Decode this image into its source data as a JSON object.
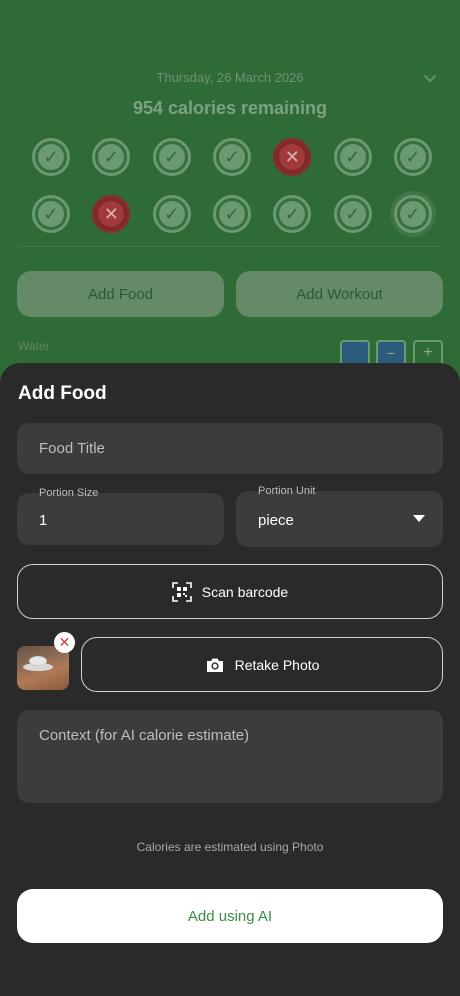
{
  "background": {
    "date": "Thursday, 26 March 2026",
    "calories_remaining": "954 calories remaining",
    "days_row1": [
      {
        "status": "check",
        "symbol": "✓"
      },
      {
        "status": "check",
        "symbol": "✓"
      },
      {
        "status": "check",
        "symbol": "✓"
      },
      {
        "status": "check",
        "symbol": "✓"
      },
      {
        "status": "fail",
        "symbol": "✕"
      },
      {
        "status": "check",
        "symbol": "✓"
      },
      {
        "status": "check",
        "symbol": "✓"
      }
    ],
    "days_row2": [
      {
        "status": "check",
        "symbol": "✓"
      },
      {
        "status": "fail",
        "symbol": "✕"
      },
      {
        "status": "check",
        "symbol": "✓"
      },
      {
        "status": "check",
        "symbol": "✓"
      },
      {
        "status": "check",
        "symbol": "✓"
      },
      {
        "status": "check",
        "symbol": "✓"
      },
      {
        "status": "today",
        "symbol": "✓"
      }
    ],
    "add_food_label": "Add Food",
    "add_workout_label": "Add Workout",
    "water_label": "Water",
    "water_cup_minus": "−",
    "water_plus": "+"
  },
  "sheet": {
    "title": "Add Food",
    "food_title_placeholder": "Food Title",
    "portion_size_label": "Portion Size",
    "portion_size_value": "1",
    "portion_unit_label": "Portion Unit",
    "portion_unit_value": "piece",
    "scan_barcode_label": "Scan barcode",
    "retake_photo_label": "Retake Photo",
    "remove_photo_symbol": "✕",
    "context_placeholder": "Context (for AI calorie estimate)",
    "hint": "Calories are estimated using Photo",
    "add_using_ai_label": "Add using AI"
  },
  "colors": {
    "background_green": "#2e6b37",
    "sheet_bg": "#2a2a2a",
    "field_bg": "#3c3c3c",
    "accent_green": "#3a8b48",
    "fail_red": "#a23a3a"
  },
  "icons": {
    "chevron": "chevron-down-icon",
    "barcode": "qr-scan-icon",
    "camera": "camera-icon",
    "remove": "close-icon"
  }
}
